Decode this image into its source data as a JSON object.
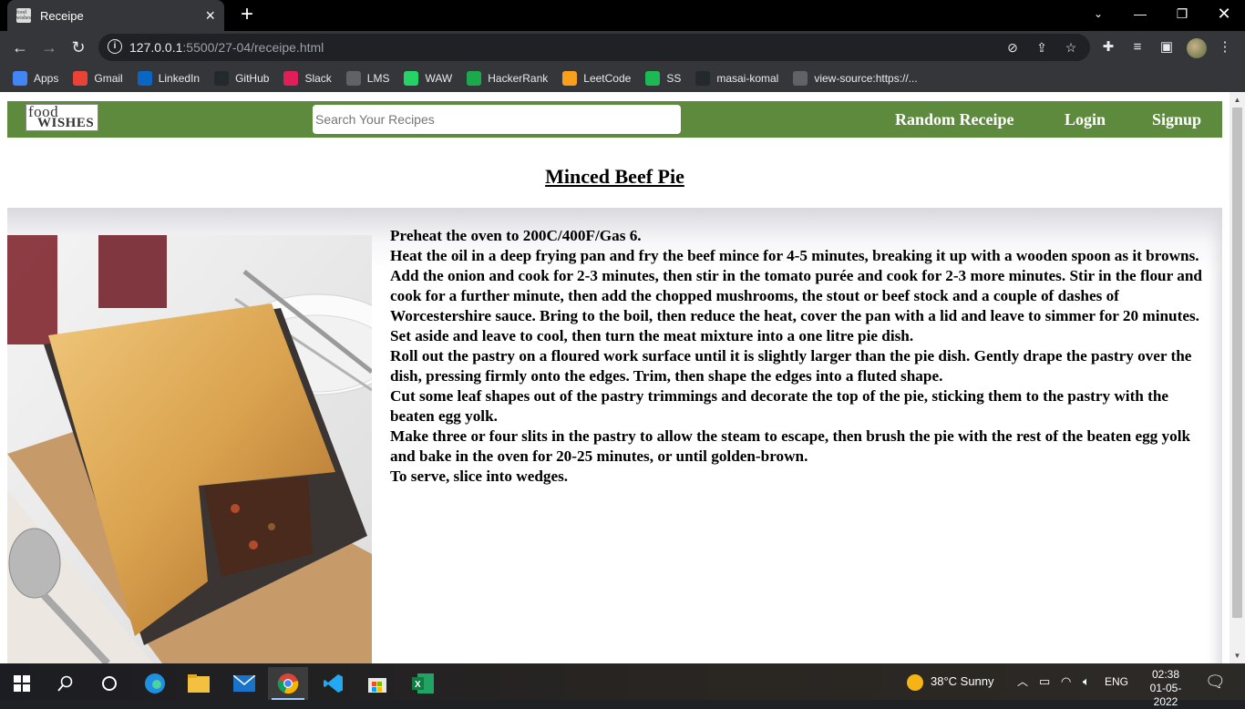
{
  "browser": {
    "tab_title": "Receipe",
    "favicon_text": "food wishes",
    "url_host": "127.0.0.1",
    "url_rest": ":5500/27-04/receipe.html",
    "bookmarks": [
      {
        "label": "Apps",
        "icon": "apps-grid-icon",
        "color": "#4285f4"
      },
      {
        "label": "Gmail",
        "icon": "gmail-icon",
        "color": "#ea4335"
      },
      {
        "label": "LinkedIn",
        "icon": "linkedin-icon",
        "color": "#0a66c2"
      },
      {
        "label": "GitHub",
        "icon": "github-icon",
        "color": "#24292e"
      },
      {
        "label": "Slack",
        "icon": "slack-icon",
        "color": "#e01e5a"
      },
      {
        "label": "LMS",
        "icon": "globe-icon",
        "color": "#5f6368"
      },
      {
        "label": "WAW",
        "icon": "whatsapp-icon",
        "color": "#25d366"
      },
      {
        "label": "HackerRank",
        "icon": "hackerrank-icon",
        "color": "#1ba94c"
      },
      {
        "label": "LeetCode",
        "icon": "leetcode-icon",
        "color": "#f89f1b"
      },
      {
        "label": "SS",
        "icon": "spotify-icon",
        "color": "#1db954"
      },
      {
        "label": "masai-komal",
        "icon": "github-icon",
        "color": "#24292e"
      },
      {
        "label": "view-source:https://...",
        "icon": "globe-icon",
        "color": "#5f6368"
      }
    ]
  },
  "site": {
    "logo_line1": "food",
    "logo_line2": "WISHES",
    "search_placeholder": "Search Your Recipes",
    "nav": {
      "random": "Random Receipe",
      "login": "Login",
      "signup": "Signup"
    },
    "accent_color": "#5e8a3e"
  },
  "recipe": {
    "title": "Minced Beef Pie",
    "image_subject": "minced beef pie with golden pastry crust in a baking tin",
    "steps": [
      "Preheat the oven to 200C/400F/Gas 6.",
      "Heat the oil in a deep frying pan and fry the beef mince for 4-5 minutes, breaking it up with a wooden spoon as it browns.",
      "Add the onion and cook for 2-3 minutes, then stir in the tomato purée and cook for 2-3 more minutes. Stir in the flour and cook for a further minute, then add the chopped mushrooms, the stout or beef stock and a couple of dashes of Worcestershire sauce. Bring to the boil, then reduce the heat, cover the pan with a lid and leave to simmer for 20 minutes. Set aside and leave to cool, then turn the meat mixture into a one litre pie dish.",
      "Roll out the pastry on a floured work surface until it is slightly larger than the pie dish. Gently drape the pastry over the dish, pressing firmly onto the edges. Trim, then shape the edges into a fluted shape.",
      "Cut some leaf shapes out of the pastry trimmings and decorate the top of the pie, sticking them to the pastry with the beaten egg yolk.",
      "Make three or four slits in the pastry to allow the steam to escape, then brush the pie with the rest of the beaten egg yolk and bake in the oven for 20-25 minutes, or until golden-brown.",
      "To serve, slice into wedges."
    ]
  },
  "taskbar": {
    "weather": "38°C  Sunny",
    "language": "ENG",
    "time": "02:38",
    "date": "01-05-2022"
  }
}
